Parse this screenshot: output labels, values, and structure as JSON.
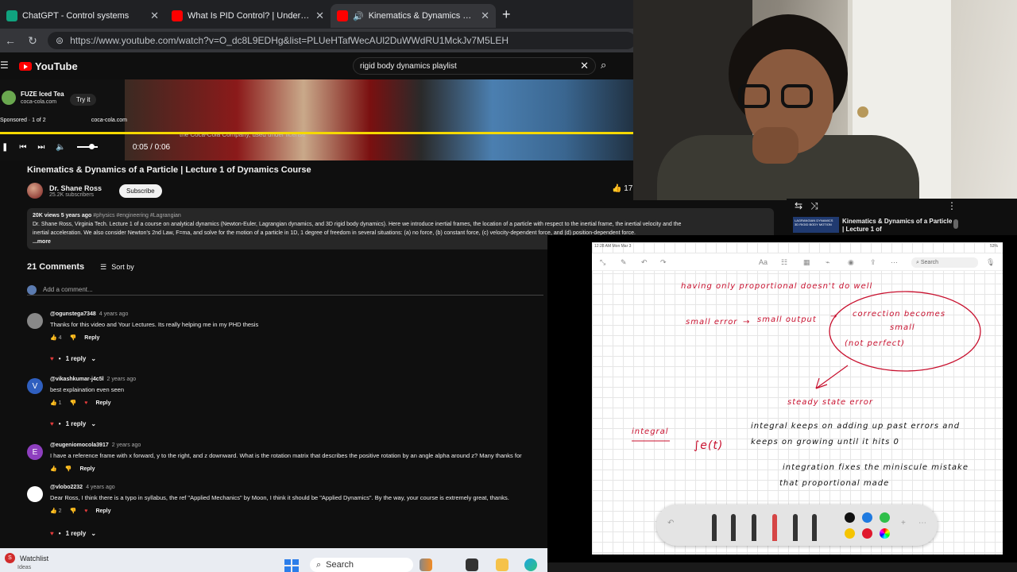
{
  "browser": {
    "tabs": [
      {
        "title": "ChatGPT - Control systems",
        "favicon_color": "#10a37f",
        "active": false
      },
      {
        "title": "What Is PID Control? | Understand",
        "favicon_color": "#ff0000",
        "active": false
      },
      {
        "title": "Kinematics & Dynamics of a Particle",
        "favicon_color": "#ff0000",
        "active": true
      }
    ],
    "url": "https://www.youtube.com/watch?v=O_dc8L9EDHg&list=PLUeHTafWecAUl2DuWWdRU1MckJv7M5LEH"
  },
  "youtube": {
    "logo": "YouTube",
    "search_value": "rigid body dynamics playlist",
    "ad": {
      "title": "FUZE Iced Tea",
      "site": "coca-cola.com",
      "cta": "Try it",
      "sponsored": "Sponsored · 1 of 2",
      "sponsored_site": "coca-cola.com",
      "caption": "the Coca-Cola Company, used under license"
    },
    "time": "0:05 / 0:06",
    "video_title": "Kinematics & Dynamics of a Particle | Lecture 1 of Dynamics Course",
    "channel": {
      "name": "Dr. Shane Ross",
      "subs": "25.2K subscribers",
      "subscribe": "Subscribe"
    },
    "likes": "17",
    "description": {
      "meta": "20K views 5 years ago",
      "tags": "#physics #engineering #Lagrangian",
      "line1": "Dr. Shane Ross, Virginia Tech. Lecture 1 of a course on analytical dynamics (Newton-Euler, Lagrangian dynamics, and 3D rigid body dynamics). Here we introduce inertial frames, the location of a particle with respect to the inertial frame, the inertial velocity and the",
      "line2": "inertial acceleration. We also consider Newton's 2nd Law, F=ma, and solve for the motion of a particle in 1D, 1 degree of freedom in several situations: (a) no force, (b) constant force, (c) velocity-dependent force, and (d) position-dependent force.",
      "more": "...more"
    },
    "comments_count": "21 Comments",
    "sort_by": "Sort by",
    "add_comment": "Add a comment...",
    "comments": [
      {
        "handle": "@ogunstega7348",
        "age": "4 years ago",
        "text": "Thanks for this video and Your Lectures. Its really helping me in my PHD thesis",
        "likes": "4",
        "replies": "1 reply",
        "avatar_color": "#888",
        "initial": "",
        "heart": false
      },
      {
        "handle": "@vikashkumar-j4c5l",
        "age": "2 years ago",
        "text": "best explaination even seen",
        "likes": "1",
        "replies": "1 reply",
        "avatar_color": "#2f5fbf",
        "initial": "V",
        "heart": true
      },
      {
        "handle": "@eugeniomocola3917",
        "age": "2 years ago",
        "text": "I have a reference frame with x forward, y to the right, and z downward. What is the rotation matrix that describes the positive rotation by an angle alpha around z? Many thanks for",
        "likes": "",
        "replies": "",
        "avatar_color": "#8e3fbf",
        "initial": "E",
        "heart": false
      },
      {
        "handle": "@vlobo2232",
        "age": "4 years ago",
        "text": "Dear Ross, I think there is a typo in syllabus, the ref \"Applied Mechanics\" by Moon, I think it should be \"Applied Dynamics\". By the way, your course is extremely great, thanks.",
        "likes": "2",
        "replies": "1 reply",
        "avatar_color": "#ffffff",
        "initial": "",
        "heart": true
      }
    ],
    "reply_label": "Reply",
    "side": {
      "next_title": "Kinematics & Dynamics of a Particle | Lecture 1 of",
      "thumb_text": "LAGRANGIAN DYNAMICS 3D RIGID BODY MOTION"
    }
  },
  "notes": {
    "status_time": "12:28 AM  Mon Mar 3",
    "status_battery": "53%",
    "search": "Search",
    "handwriting": {
      "line1": "having only proportional doesn't do well",
      "small_error": "small error",
      "small_output": "small output",
      "correction": "correction becomes",
      "small": "small",
      "not_perfect": "(not perfect)",
      "steady": "steady state error",
      "integral": "integral",
      "integral_sym": "∫e(t)",
      "int_line1": "integral keeps on adding up past errors and",
      "int_line2": "keeps on growing until it hits 0",
      "int_line3": "integration fixes the miniscule mistake",
      "int_line4": "that proportional made"
    }
  },
  "taskbar": {
    "watchlist": "Watchlist",
    "watchlist_sub": "Ideas",
    "search": "Search"
  },
  "colors": {
    "yt_red": "#ff0000",
    "ink_red": "#c8102e",
    "progress": "#f5d800"
  }
}
